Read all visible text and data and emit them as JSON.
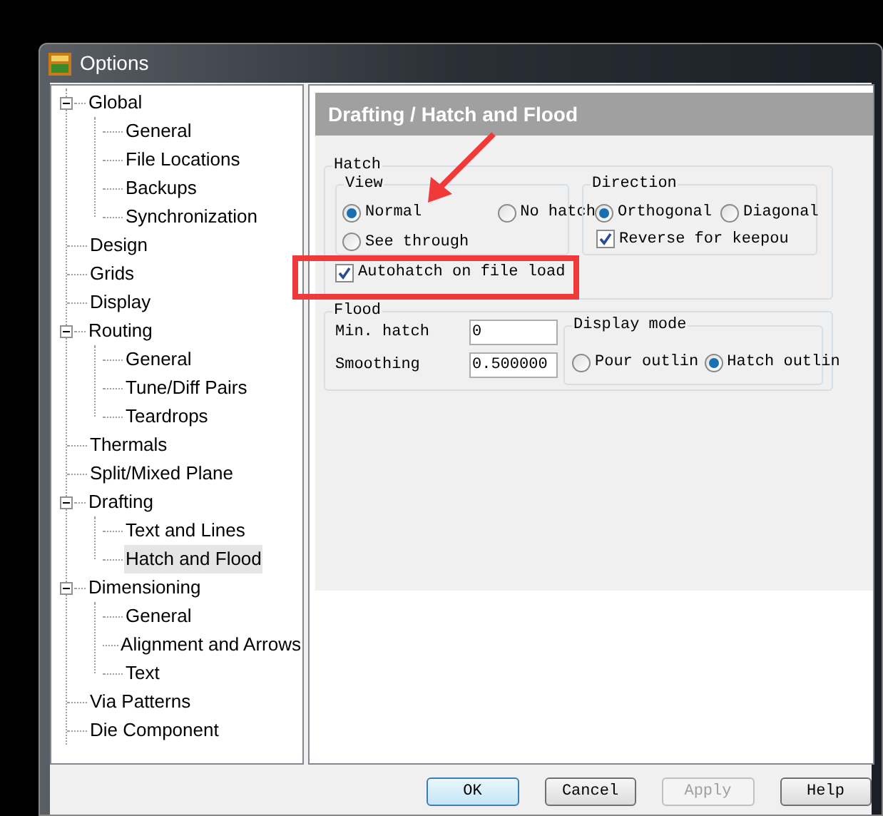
{
  "window": {
    "title": "Options"
  },
  "tree": [
    {
      "label": "Global",
      "expanded": true,
      "selected": false,
      "children": [
        {
          "label": "General",
          "selected": false
        },
        {
          "label": "File Locations",
          "selected": false
        },
        {
          "label": "Backups",
          "selected": false
        },
        {
          "label": "Synchronization",
          "selected": false
        }
      ]
    },
    {
      "label": "Design",
      "selected": false
    },
    {
      "label": "Grids",
      "selected": false
    },
    {
      "label": "Display",
      "selected": false
    },
    {
      "label": "Routing",
      "expanded": true,
      "selected": false,
      "children": [
        {
          "label": "General",
          "selected": false
        },
        {
          "label": "Tune/Diff Pairs",
          "selected": false
        },
        {
          "label": "Teardrops",
          "selected": false
        }
      ]
    },
    {
      "label": "Thermals",
      "selected": false
    },
    {
      "label": "Split/Mixed Plane",
      "selected": false
    },
    {
      "label": "Drafting",
      "expanded": true,
      "selected": false,
      "children": [
        {
          "label": "Text and Lines",
          "selected": false
        },
        {
          "label": "Hatch and Flood",
          "selected": true
        }
      ]
    },
    {
      "label": "Dimensioning",
      "expanded": true,
      "selected": false,
      "children": [
        {
          "label": "General",
          "selected": false
        },
        {
          "label": "Alignment and Arrows",
          "selected": false
        },
        {
          "label": "Text",
          "selected": false
        }
      ]
    },
    {
      "label": "Via Patterns",
      "selected": false
    },
    {
      "label": "Die Component",
      "selected": false
    }
  ],
  "page_title": "Drafting / Hatch and Flood",
  "hatch": {
    "title": "Hatch",
    "view": {
      "title": "View",
      "options": [
        {
          "label": "Normal",
          "selected": true
        },
        {
          "label": "No hatch",
          "selected": false
        },
        {
          "label": "See through",
          "selected": false
        }
      ]
    },
    "direction": {
      "title": "Direction",
      "options": [
        {
          "label": "Orthogonal",
          "selected": true
        },
        {
          "label": "Diagonal",
          "selected": false
        }
      ],
      "reverse": {
        "label": "Reverse for keepou",
        "checked": true
      }
    },
    "autohatch": {
      "label": "Autohatch on file load",
      "checked": true
    }
  },
  "flood": {
    "title": "Flood",
    "fields": [
      {
        "label": "Min. hatch",
        "value": "0"
      },
      {
        "label": "Smoothing",
        "value": "0.500000"
      }
    ],
    "display_mode": {
      "title": "Display mode",
      "options": [
        {
          "label": "Pour outlin",
          "selected": false
        },
        {
          "label": "Hatch outlin",
          "selected": true
        }
      ]
    }
  },
  "buttons": [
    {
      "label": "OK",
      "default": true,
      "disabled": false
    },
    {
      "label": "Cancel",
      "default": false,
      "disabled": false
    },
    {
      "label": "Apply",
      "default": false,
      "disabled": true
    },
    {
      "label": "Help",
      "default": false,
      "disabled": false
    }
  ]
}
